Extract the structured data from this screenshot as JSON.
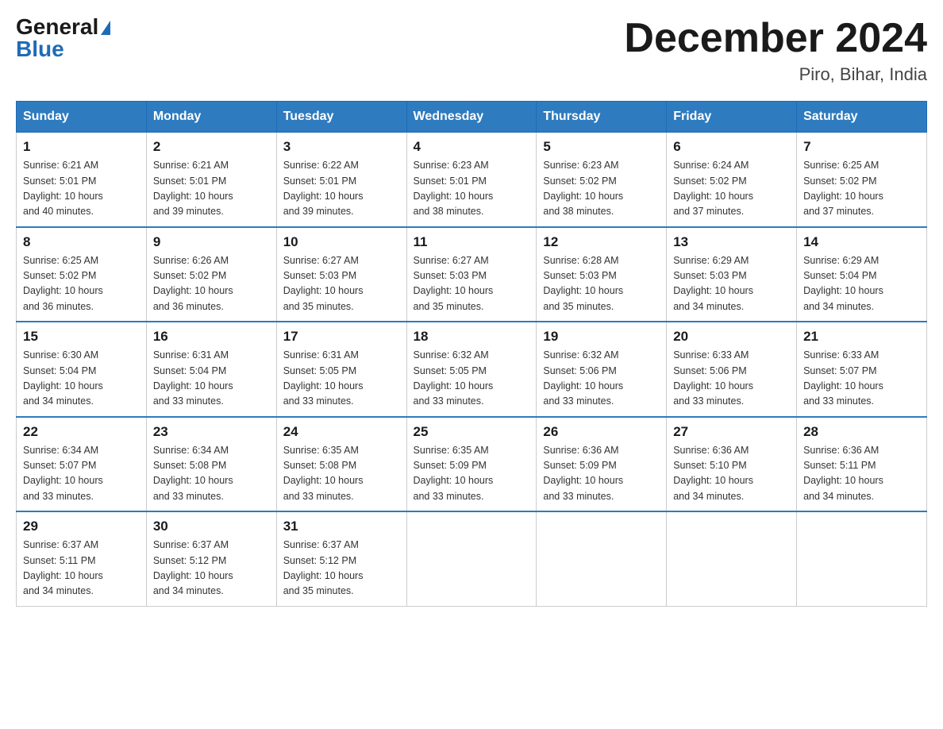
{
  "header": {
    "logo_general": "General",
    "logo_blue": "Blue",
    "month_title": "December 2024",
    "location": "Piro, Bihar, India"
  },
  "days_of_week": [
    "Sunday",
    "Monday",
    "Tuesday",
    "Wednesday",
    "Thursday",
    "Friday",
    "Saturday"
  ],
  "weeks": [
    [
      {
        "day": "1",
        "sunrise": "6:21 AM",
        "sunset": "5:01 PM",
        "daylight": "10 hours and 40 minutes."
      },
      {
        "day": "2",
        "sunrise": "6:21 AM",
        "sunset": "5:01 PM",
        "daylight": "10 hours and 39 minutes."
      },
      {
        "day": "3",
        "sunrise": "6:22 AM",
        "sunset": "5:01 PM",
        "daylight": "10 hours and 39 minutes."
      },
      {
        "day": "4",
        "sunrise": "6:23 AM",
        "sunset": "5:01 PM",
        "daylight": "10 hours and 38 minutes."
      },
      {
        "day": "5",
        "sunrise": "6:23 AM",
        "sunset": "5:02 PM",
        "daylight": "10 hours and 38 minutes."
      },
      {
        "day": "6",
        "sunrise": "6:24 AM",
        "sunset": "5:02 PM",
        "daylight": "10 hours and 37 minutes."
      },
      {
        "day": "7",
        "sunrise": "6:25 AM",
        "sunset": "5:02 PM",
        "daylight": "10 hours and 37 minutes."
      }
    ],
    [
      {
        "day": "8",
        "sunrise": "6:25 AM",
        "sunset": "5:02 PM",
        "daylight": "10 hours and 36 minutes."
      },
      {
        "day": "9",
        "sunrise": "6:26 AM",
        "sunset": "5:02 PM",
        "daylight": "10 hours and 36 minutes."
      },
      {
        "day": "10",
        "sunrise": "6:27 AM",
        "sunset": "5:03 PM",
        "daylight": "10 hours and 35 minutes."
      },
      {
        "day": "11",
        "sunrise": "6:27 AM",
        "sunset": "5:03 PM",
        "daylight": "10 hours and 35 minutes."
      },
      {
        "day": "12",
        "sunrise": "6:28 AM",
        "sunset": "5:03 PM",
        "daylight": "10 hours and 35 minutes."
      },
      {
        "day": "13",
        "sunrise": "6:29 AM",
        "sunset": "5:03 PM",
        "daylight": "10 hours and 34 minutes."
      },
      {
        "day": "14",
        "sunrise": "6:29 AM",
        "sunset": "5:04 PM",
        "daylight": "10 hours and 34 minutes."
      }
    ],
    [
      {
        "day": "15",
        "sunrise": "6:30 AM",
        "sunset": "5:04 PM",
        "daylight": "10 hours and 34 minutes."
      },
      {
        "day": "16",
        "sunrise": "6:31 AM",
        "sunset": "5:04 PM",
        "daylight": "10 hours and 33 minutes."
      },
      {
        "day": "17",
        "sunrise": "6:31 AM",
        "sunset": "5:05 PM",
        "daylight": "10 hours and 33 minutes."
      },
      {
        "day": "18",
        "sunrise": "6:32 AM",
        "sunset": "5:05 PM",
        "daylight": "10 hours and 33 minutes."
      },
      {
        "day": "19",
        "sunrise": "6:32 AM",
        "sunset": "5:06 PM",
        "daylight": "10 hours and 33 minutes."
      },
      {
        "day": "20",
        "sunrise": "6:33 AM",
        "sunset": "5:06 PM",
        "daylight": "10 hours and 33 minutes."
      },
      {
        "day": "21",
        "sunrise": "6:33 AM",
        "sunset": "5:07 PM",
        "daylight": "10 hours and 33 minutes."
      }
    ],
    [
      {
        "day": "22",
        "sunrise": "6:34 AM",
        "sunset": "5:07 PM",
        "daylight": "10 hours and 33 minutes."
      },
      {
        "day": "23",
        "sunrise": "6:34 AM",
        "sunset": "5:08 PM",
        "daylight": "10 hours and 33 minutes."
      },
      {
        "day": "24",
        "sunrise": "6:35 AM",
        "sunset": "5:08 PM",
        "daylight": "10 hours and 33 minutes."
      },
      {
        "day": "25",
        "sunrise": "6:35 AM",
        "sunset": "5:09 PM",
        "daylight": "10 hours and 33 minutes."
      },
      {
        "day": "26",
        "sunrise": "6:36 AM",
        "sunset": "5:09 PM",
        "daylight": "10 hours and 33 minutes."
      },
      {
        "day": "27",
        "sunrise": "6:36 AM",
        "sunset": "5:10 PM",
        "daylight": "10 hours and 34 minutes."
      },
      {
        "day": "28",
        "sunrise": "6:36 AM",
        "sunset": "5:11 PM",
        "daylight": "10 hours and 34 minutes."
      }
    ],
    [
      {
        "day": "29",
        "sunrise": "6:37 AM",
        "sunset": "5:11 PM",
        "daylight": "10 hours and 34 minutes."
      },
      {
        "day": "30",
        "sunrise": "6:37 AM",
        "sunset": "5:12 PM",
        "daylight": "10 hours and 34 minutes."
      },
      {
        "day": "31",
        "sunrise": "6:37 AM",
        "sunset": "5:12 PM",
        "daylight": "10 hours and 35 minutes."
      },
      null,
      null,
      null,
      null
    ]
  ],
  "labels": {
    "sunrise": "Sunrise:",
    "sunset": "Sunset:",
    "daylight": "Daylight:"
  }
}
